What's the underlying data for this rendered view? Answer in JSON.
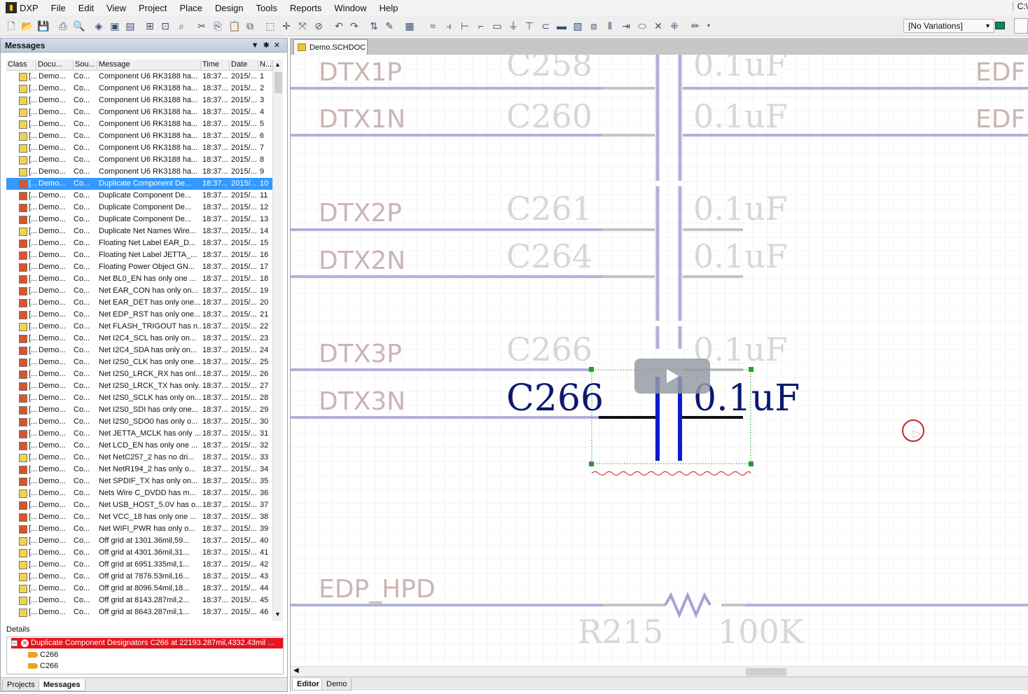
{
  "app": {
    "menu": [
      "DXP",
      "File",
      "Edit",
      "View",
      "Project",
      "Place",
      "Design",
      "Tools",
      "Reports",
      "Window",
      "Help"
    ],
    "right_label": "C:\\",
    "variations": "[No Variations]"
  },
  "messages_panel": {
    "title": "Messages",
    "columns": [
      "Class",
      "Docu...",
      "Sou...",
      "Message",
      "Time",
      "Date",
      "N..."
    ],
    "rows": [
      {
        "cls": "[...",
        "doc": "Demo...",
        "src": "Co...",
        "msg": "Component U6 RK3188 ha...",
        "time": "18:37...",
        "date": "2015/...",
        "n": "1",
        "level": "warning"
      },
      {
        "cls": "[...",
        "doc": "Demo...",
        "src": "Co...",
        "msg": "Component U6 RK3188 ha...",
        "time": "18:37...",
        "date": "2015/...",
        "n": "2",
        "level": "warning"
      },
      {
        "cls": "[...",
        "doc": "Demo...",
        "src": "Co...",
        "msg": "Component U6 RK3188 ha...",
        "time": "18:37...",
        "date": "2015/...",
        "n": "3",
        "level": "warning"
      },
      {
        "cls": "[...",
        "doc": "Demo...",
        "src": "Co...",
        "msg": "Component U6 RK3188 ha...",
        "time": "18:37...",
        "date": "2015/...",
        "n": "4",
        "level": "warning"
      },
      {
        "cls": "[...",
        "doc": "Demo...",
        "src": "Co...",
        "msg": "Component U6 RK3188 ha...",
        "time": "18:37...",
        "date": "2015/...",
        "n": "5",
        "level": "warning"
      },
      {
        "cls": "[...",
        "doc": "Demo...",
        "src": "Co...",
        "msg": "Component U6 RK3188 ha...",
        "time": "18:37...",
        "date": "2015/...",
        "n": "6",
        "level": "warning"
      },
      {
        "cls": "[...",
        "doc": "Demo...",
        "src": "Co...",
        "msg": "Component U6 RK3188 ha...",
        "time": "18:37...",
        "date": "2015/...",
        "n": "7",
        "level": "warning"
      },
      {
        "cls": "[...",
        "doc": "Demo...",
        "src": "Co...",
        "msg": "Component U6 RK3188 ha...",
        "time": "18:37...",
        "date": "2015/...",
        "n": "8",
        "level": "warning"
      },
      {
        "cls": "[...",
        "doc": "Demo...",
        "src": "Co...",
        "msg": "Component U6 RK3188 ha...",
        "time": "18:37...",
        "date": "2015/...",
        "n": "9",
        "level": "warning"
      },
      {
        "cls": "[...",
        "doc": "Demo...",
        "src": "Co...",
        "msg": "Duplicate Component De...",
        "time": "18:37...",
        "date": "2015/...",
        "n": "10",
        "level": "error",
        "selected": true
      },
      {
        "cls": "[...",
        "doc": "Demo...",
        "src": "Co...",
        "msg": "Duplicate Component De...",
        "time": "18:37...",
        "date": "2015/...",
        "n": "11",
        "level": "error"
      },
      {
        "cls": "[...",
        "doc": "Demo...",
        "src": "Co...",
        "msg": "Duplicate Component De...",
        "time": "18:37...",
        "date": "2015/...",
        "n": "12",
        "level": "error"
      },
      {
        "cls": "[...",
        "doc": "Demo...",
        "src": "Co...",
        "msg": "Duplicate Component De...",
        "time": "18:37...",
        "date": "2015/...",
        "n": "13",
        "level": "error"
      },
      {
        "cls": "[...",
        "doc": "Demo...",
        "src": "Co...",
        "msg": "Duplicate Net Names Wire...",
        "time": "18:37...",
        "date": "2015/...",
        "n": "14",
        "level": "warning"
      },
      {
        "cls": "[...",
        "doc": "Demo...",
        "src": "Co...",
        "msg": "Floating Net Label EAR_D...",
        "time": "18:37...",
        "date": "2015/...",
        "n": "15",
        "level": "error"
      },
      {
        "cls": "[...",
        "doc": "Demo...",
        "src": "Co...",
        "msg": "Floating Net Label JETTA_...",
        "time": "18:37...",
        "date": "2015/...",
        "n": "16",
        "level": "error"
      },
      {
        "cls": "[...",
        "doc": "Demo...",
        "src": "Co...",
        "msg": "Floating Power Object GN...",
        "time": "18:37...",
        "date": "2015/...",
        "n": "17",
        "level": "error"
      },
      {
        "cls": "[...",
        "doc": "Demo...",
        "src": "Co...",
        "msg": "Net BL0_EN has only one ...",
        "time": "18:37...",
        "date": "2015/...",
        "n": "18",
        "level": "error"
      },
      {
        "cls": "[...",
        "doc": "Demo...",
        "src": "Co...",
        "msg": "Net EAR_CON has only on...",
        "time": "18:37...",
        "date": "2015/...",
        "n": "19",
        "level": "error"
      },
      {
        "cls": "[...",
        "doc": "Demo...",
        "src": "Co...",
        "msg": "Net EAR_DET has only one...",
        "time": "18:37...",
        "date": "2015/...",
        "n": "20",
        "level": "error"
      },
      {
        "cls": "[...",
        "doc": "Demo...",
        "src": "Co...",
        "msg": "Net EDP_RST has only one...",
        "time": "18:37...",
        "date": "2015/...",
        "n": "21",
        "level": "error"
      },
      {
        "cls": "[...",
        "doc": "Demo...",
        "src": "Co...",
        "msg": "Net FLASH_TRIGOUT has n...",
        "time": "18:37...",
        "date": "2015/...",
        "n": "22",
        "level": "warning"
      },
      {
        "cls": "[...",
        "doc": "Demo...",
        "src": "Co...",
        "msg": "Net I2C4_SCL has only on...",
        "time": "18:37...",
        "date": "2015/...",
        "n": "23",
        "level": "error"
      },
      {
        "cls": "[...",
        "doc": "Demo...",
        "src": "Co...",
        "msg": "Net I2C4_SDA has only on...",
        "time": "18:37...",
        "date": "2015/...",
        "n": "24",
        "level": "error"
      },
      {
        "cls": "[...",
        "doc": "Demo...",
        "src": "Co...",
        "msg": "Net I2S0_CLK has only one...",
        "time": "18:37...",
        "date": "2015/...",
        "n": "25",
        "level": "error"
      },
      {
        "cls": "[...",
        "doc": "Demo...",
        "src": "Co...",
        "msg": "Net I2S0_LRCK_RX has onl...",
        "time": "18:37...",
        "date": "2015/...",
        "n": "26",
        "level": "error"
      },
      {
        "cls": "[...",
        "doc": "Demo...",
        "src": "Co...",
        "msg": "Net I2S0_LRCK_TX has only...",
        "time": "18:37...",
        "date": "2015/...",
        "n": "27",
        "level": "error"
      },
      {
        "cls": "[...",
        "doc": "Demo...",
        "src": "Co...",
        "msg": "Net I2S0_SCLK has only on...",
        "time": "18:37...",
        "date": "2015/...",
        "n": "28",
        "level": "error"
      },
      {
        "cls": "[...",
        "doc": "Demo...",
        "src": "Co...",
        "msg": "Net I2S0_SDI has only one...",
        "time": "18:37...",
        "date": "2015/...",
        "n": "29",
        "level": "error"
      },
      {
        "cls": "[...",
        "doc": "Demo...",
        "src": "Co...",
        "msg": "Net I2S0_SDO0 has only o...",
        "time": "18:37...",
        "date": "2015/...",
        "n": "30",
        "level": "error"
      },
      {
        "cls": "[...",
        "doc": "Demo...",
        "src": "Co...",
        "msg": "Net JETTA_MCLK has only ...",
        "time": "18:37...",
        "date": "2015/...",
        "n": "31",
        "level": "error"
      },
      {
        "cls": "[...",
        "doc": "Demo...",
        "src": "Co...",
        "msg": "Net LCD_EN has only one ...",
        "time": "18:37...",
        "date": "2015/...",
        "n": "32",
        "level": "error"
      },
      {
        "cls": "[...",
        "doc": "Demo...",
        "src": "Co...",
        "msg": "Net NetC257_2 has no dri...",
        "time": "18:37...",
        "date": "2015/...",
        "n": "33",
        "level": "warning"
      },
      {
        "cls": "[...",
        "doc": "Demo...",
        "src": "Co...",
        "msg": "Net NetR194_2 has only o...",
        "time": "18:37...",
        "date": "2015/...",
        "n": "34",
        "level": "error"
      },
      {
        "cls": "[...",
        "doc": "Demo...",
        "src": "Co...",
        "msg": "Net SPDIF_TX has only on...",
        "time": "18:37...",
        "date": "2015/...",
        "n": "35",
        "level": "error"
      },
      {
        "cls": "[...",
        "doc": "Demo...",
        "src": "Co...",
        "msg": "Nets Wire C_DVDD has m...",
        "time": "18:37...",
        "date": "2015/...",
        "n": "36",
        "level": "warning"
      },
      {
        "cls": "[...",
        "doc": "Demo...",
        "src": "Co...",
        "msg": "Net USB_HOST_5.0V has o...",
        "time": "18:37...",
        "date": "2015/...",
        "n": "37",
        "level": "error"
      },
      {
        "cls": "[...",
        "doc": "Demo...",
        "src": "Co...",
        "msg": "Net VCC_18 has only one ...",
        "time": "18:37...",
        "date": "2015/...",
        "n": "38",
        "level": "error"
      },
      {
        "cls": "[...",
        "doc": "Demo...",
        "src": "Co...",
        "msg": "Net WIFI_PWR has only o...",
        "time": "18:37...",
        "date": "2015/...",
        "n": "39",
        "level": "error"
      },
      {
        "cls": "[...",
        "doc": "Demo...",
        "src": "Co...",
        "msg": "Off grid  at 1301.36mil,59...",
        "time": "18:37...",
        "date": "2015/...",
        "n": "40",
        "level": "warning"
      },
      {
        "cls": "[...",
        "doc": "Demo...",
        "src": "Co...",
        "msg": "Off grid  at 4301.36mil,31...",
        "time": "18:37...",
        "date": "2015/...",
        "n": "41",
        "level": "warning"
      },
      {
        "cls": "[...",
        "doc": "Demo...",
        "src": "Co...",
        "msg": "Off grid  at 6951.335mil,1...",
        "time": "18:37...",
        "date": "2015/...",
        "n": "42",
        "level": "warning"
      },
      {
        "cls": "[...",
        "doc": "Demo...",
        "src": "Co...",
        "msg": "Off grid  at 7876.53mil,16...",
        "time": "18:37...",
        "date": "2015/...",
        "n": "43",
        "level": "warning"
      },
      {
        "cls": "[...",
        "doc": "Demo...",
        "src": "Co...",
        "msg": "Off grid  at 8096.54mil,18...",
        "time": "18:37...",
        "date": "2015/...",
        "n": "44",
        "level": "warning"
      },
      {
        "cls": "[...",
        "doc": "Demo...",
        "src": "Co...",
        "msg": "Off grid  at 8143.287mil,2...",
        "time": "18:37...",
        "date": "2015/...",
        "n": "45",
        "level": "warning"
      },
      {
        "cls": "[...",
        "doc": "Demo...",
        "src": "Co...",
        "msg": "Off grid  at 8643.287mil,1...",
        "time": "18:37...",
        "date": "2015/...",
        "n": "46",
        "level": "warning"
      }
    ],
    "details_title": "Details",
    "details_error": "Duplicate Component Designators C266 at 22193.287mil,4332.43mil ...",
    "details_items": [
      "C266",
      "C266"
    ],
    "tabs": [
      "Projects",
      "Messages"
    ]
  },
  "document": {
    "tab": "Demo.SCHDOC",
    "bottom_tabs": [
      "Editor",
      "Demo"
    ],
    "net_labels": [
      "DTX1P",
      "DTX1N",
      "DTX2P",
      "DTX2N",
      "DTX3P",
      "DTX3N",
      "EDP_HPD"
    ],
    "right_labels": [
      "EDF",
      "EDF"
    ],
    "faded_designators": [
      "C258",
      "C260",
      "C261",
      "C264",
      "C266"
    ],
    "faded_values": [
      "0.1uF",
      "0.1uF",
      "0.1uF",
      "0.1uF",
      "0.1uF"
    ],
    "selected_designator": "C266",
    "selected_value": "0.1uF",
    "resistor_designator": "R215",
    "resistor_value": "100K"
  },
  "colors": {
    "selected_row": "#3399ff",
    "error_icon": "#d9542b",
    "warning_icon": "#f2d34d",
    "wire": "#a9a9d6",
    "capacitor": "#0a1ccc",
    "designator": "#0b1a6e",
    "faded_label": "#cbb3b3",
    "faded_designator": "#d5d5d5"
  }
}
